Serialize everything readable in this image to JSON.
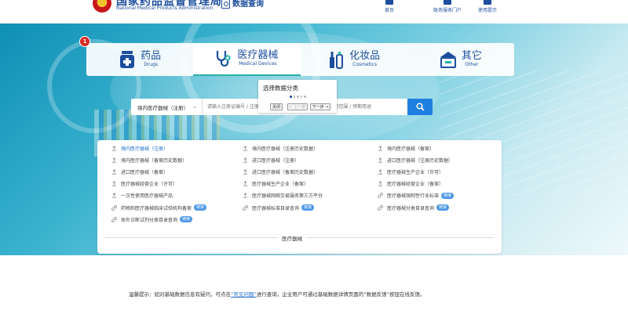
{
  "header": {
    "agency_cn": "国家药品监督管理局",
    "agency_en": "National Medical Products Administration",
    "data_query": "数据查询",
    "nav": [
      {
        "label": "首页",
        "icon": "home-icon"
      },
      {
        "label": "政务服务门户",
        "icon": "portal-icon"
      },
      {
        "label": "使用提示",
        "icon": "guide-icon"
      }
    ]
  },
  "badge": "1",
  "categories": [
    {
      "cn": "药品",
      "en": "Drugs",
      "icon": "drug-icon",
      "active": false
    },
    {
      "cn": "医疗器械",
      "en": "Medical Devices",
      "icon": "stethoscope-icon",
      "active": true
    },
    {
      "cn": "化妆品",
      "en": "Cosmetics",
      "icon": "cosmetics-icon",
      "active": false
    },
    {
      "cn": "其它",
      "en": "Other",
      "icon": "other-icon",
      "active": false
    }
  ],
  "popup": {
    "title": "选择数据分类",
    "close": "关闭",
    "prev": "← 上一步",
    "next": "下一步 →"
  },
  "search": {
    "selected": "境内医疗器械（注册）",
    "placeholder": "请输入注册证编号 / 注册人名称 / 产品名称 / 结构及组成 / 适用范围 / 预期用途"
  },
  "list": [
    [
      "境内医疗器械（注册）",
      "境内医疗器械（注册历史数据）",
      "境内医疗器械（备案）"
    ],
    [
      "境内医疗器械（备案历史数据）",
      "进口医疗器械（注册）",
      "进口医疗器械（注册历史数据）"
    ],
    [
      "进口医疗器械（备案）",
      "进口医疗器械（备案历史数据）",
      "医疗器械生产企业（许可）"
    ],
    [
      "医疗器械经营企业（许可）",
      "医疗器械生产企业（备案）",
      "医疗器械经营企业（备案）"
    ],
    [
      "一次性使用医疗器械产品",
      "医疗器械网络交易服务第三方平台",
      "医疗器械强制性行业标准"
    ],
    [
      "药物和医疗器械临床试验机构备案",
      "医疗器械标准目录查询",
      "医疗器械分类目录查询"
    ],
    [
      "体外诊断试剂分类目录查询"
    ]
  ],
  "link_label": "链接",
  "panel_footer": "医疗器械",
  "tip": {
    "prefix": "温馨提示：如对基础数据信息有疑问，可点击",
    "link": "“常见问题”",
    "suffix": "进行查询，企业用户可通过基础数据详情页面的“数据反馈”按钮在线反馈。"
  },
  "colors": {
    "brand": "#1d4e9e",
    "accent": "#1e7fe0",
    "teal": "#2ab0a5",
    "badge": "#d9281f"
  }
}
